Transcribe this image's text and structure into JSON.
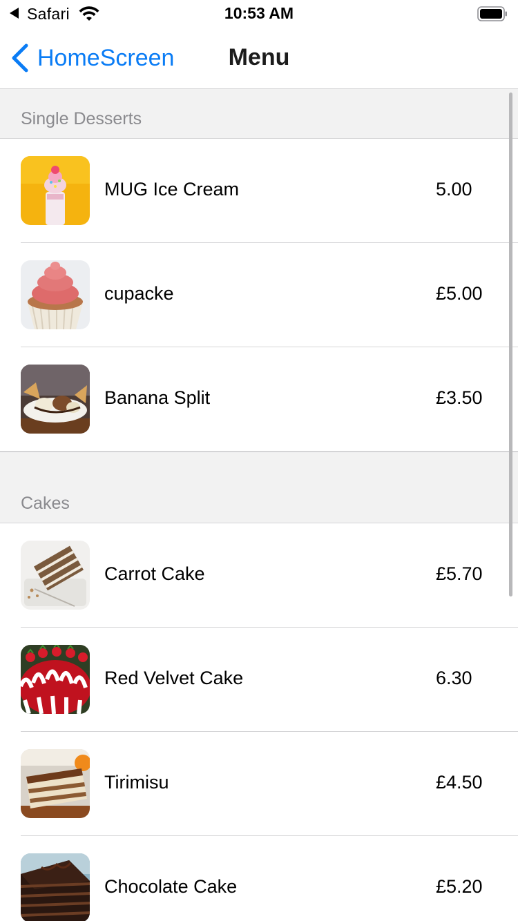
{
  "status_bar": {
    "back_app": "Safari",
    "time": "10:53 AM"
  },
  "nav": {
    "back_label": "HomeScreen",
    "title": "Menu",
    "accent": "#0a7cf5"
  },
  "sections": [
    {
      "header": "Single Desserts",
      "items": [
        {
          "name": "MUG Ice Cream",
          "price": "5.00",
          "icon": "ice-cream-photo"
        },
        {
          "name": "cupacke",
          "price": "£5.00",
          "icon": "cupcake-photo"
        },
        {
          "name": "Banana Split",
          "price": "£3.50",
          "icon": "banana-split-photo"
        }
      ]
    },
    {
      "header": "Cakes",
      "items": [
        {
          "name": "Carrot Cake",
          "price": "£5.70",
          "icon": "carrot-cake-photo"
        },
        {
          "name": "Red Velvet Cake",
          "price": "6.30",
          "icon": "red-velvet-photo"
        },
        {
          "name": "Tirimisu",
          "price": "£4.50",
          "icon": "tiramisu-photo"
        },
        {
          "name": "Chocolate Cake",
          "price": "£5.20",
          "icon": "chocolate-cake-photo"
        }
      ]
    }
  ]
}
